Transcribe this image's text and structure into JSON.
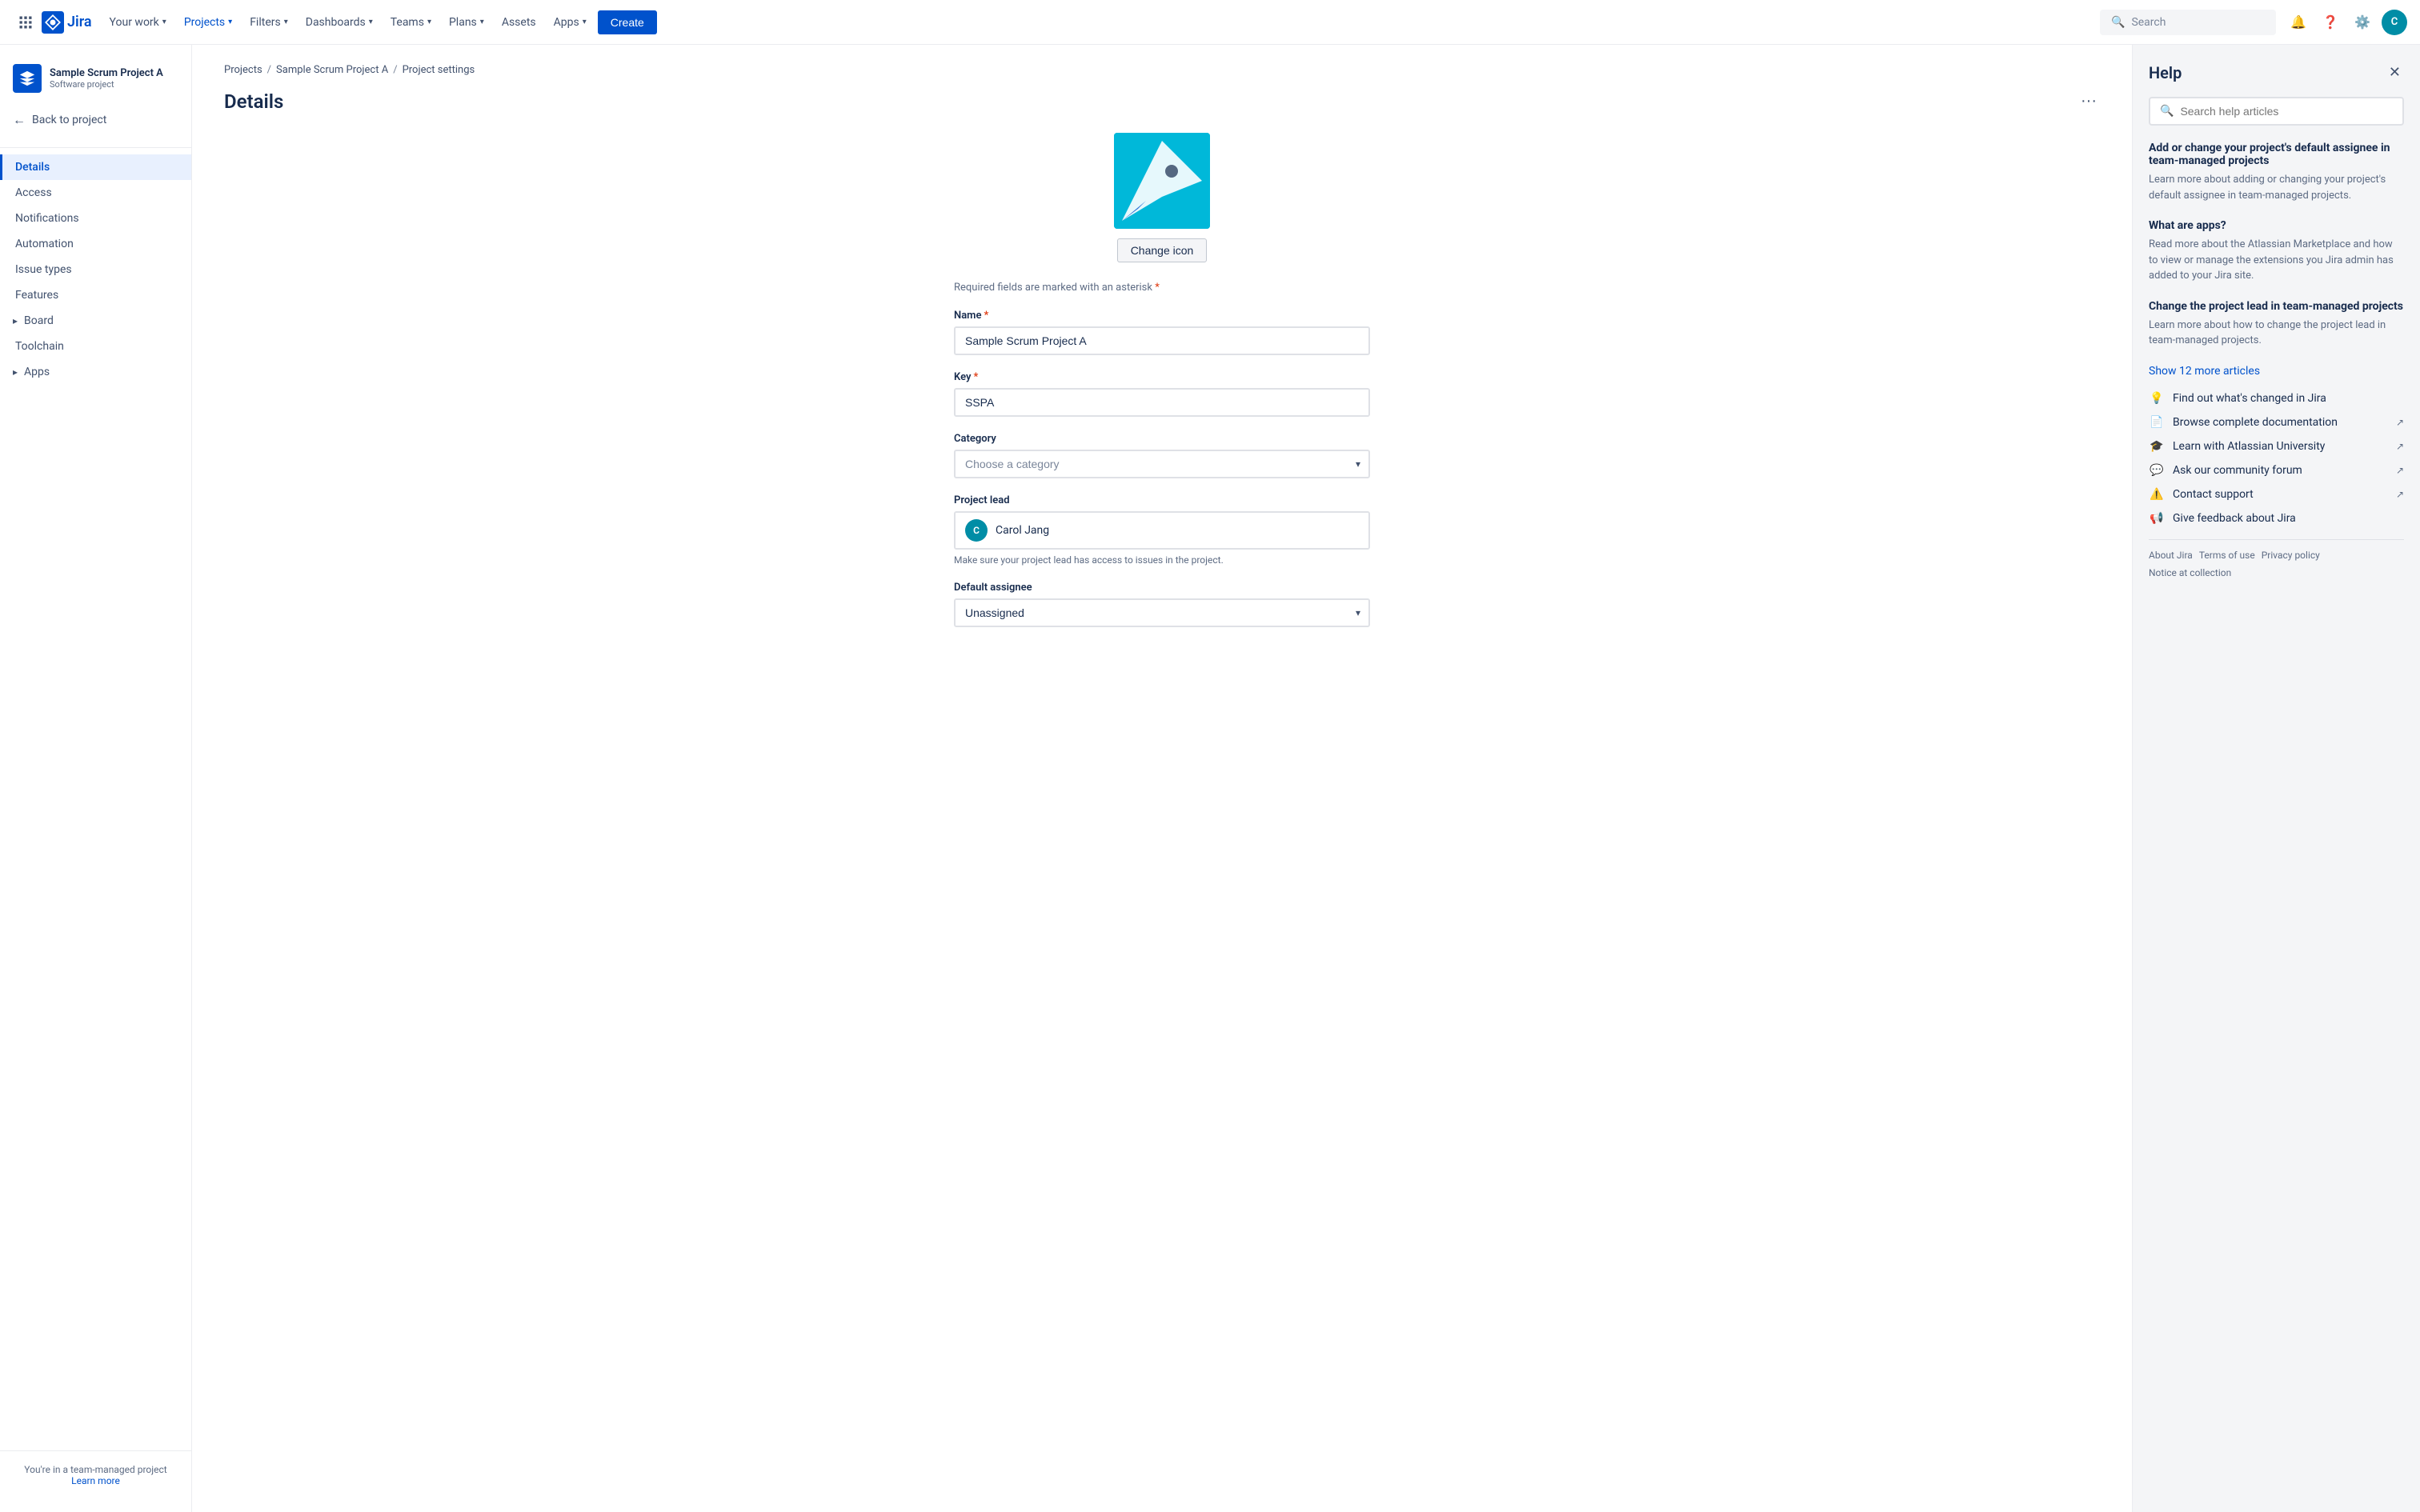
{
  "topnav": {
    "logo_text": "Jira",
    "search_placeholder": "Search",
    "nav_items": [
      {
        "label": "Your work",
        "has_chevron": true,
        "active": false
      },
      {
        "label": "Projects",
        "has_chevron": true,
        "active": true
      },
      {
        "label": "Filters",
        "has_chevron": true,
        "active": false
      },
      {
        "label": "Dashboards",
        "has_chevron": true,
        "active": false
      },
      {
        "label": "Teams",
        "has_chevron": true,
        "active": false
      },
      {
        "label": "Plans",
        "has_chevron": true,
        "active": false
      },
      {
        "label": "Assets",
        "has_chevron": false,
        "active": false
      },
      {
        "label": "Apps",
        "has_chevron": true,
        "active": false
      }
    ],
    "create_label": "Create",
    "avatar_initials": "C"
  },
  "sidebar": {
    "project_name": "Sample Scrum Project A",
    "project_type": "Software project",
    "back_label": "Back to project",
    "items": [
      {
        "label": "Details",
        "active": true
      },
      {
        "label": "Access",
        "active": false
      },
      {
        "label": "Notifications",
        "active": false
      },
      {
        "label": "Automation",
        "active": false
      },
      {
        "label": "Issue types",
        "active": false
      },
      {
        "label": "Features",
        "active": false
      }
    ],
    "expandable_items": [
      {
        "label": "Board"
      },
      {
        "label": "Toolchain"
      },
      {
        "label": "Apps"
      }
    ],
    "footer_text": "You're in a team-managed project",
    "footer_link": "Learn more"
  },
  "breadcrumb": {
    "items": [
      "Projects",
      "Sample Scrum Project A",
      "Project settings"
    ]
  },
  "page": {
    "title": "Details"
  },
  "form": {
    "required_note": "Required fields are marked with an asterisk",
    "change_icon_label": "Change icon",
    "name_label": "Name",
    "name_value": "Sample Scrum Project A",
    "key_label": "Key",
    "key_value": "SSPA",
    "category_label": "Category",
    "category_placeholder": "Choose a category",
    "project_lead_label": "Project lead",
    "project_lead_name": "Carol Jang",
    "project_lead_avatar": "C",
    "project_lead_hint": "Make sure your project lead has access to issues in the project.",
    "default_assignee_label": "Default assignee",
    "default_assignee_value": "Unassigned"
  },
  "help": {
    "title": "Help",
    "search_placeholder": "Search help articles",
    "articles": [
      {
        "title": "Add or change your project's default assignee in team-managed projects",
        "desc": "Learn more about adding or changing your project's default assignee in team-managed projects."
      },
      {
        "title": "What are apps?",
        "desc": "Read more about the Atlassian Marketplace and how to view or manage the extensions you Jira admin has added to your Jira site."
      },
      {
        "title": "Change the project lead in team-managed projects",
        "desc": "Learn more about how to change the project lead in team-managed projects."
      }
    ],
    "show_more_label": "Show 12 more articles",
    "links": [
      {
        "icon": "bulb",
        "text": "Find out what's changed in Jira",
        "external": false
      },
      {
        "icon": "doc",
        "text": "Browse complete documentation",
        "external": true
      },
      {
        "icon": "graduation",
        "text": "Learn with Atlassian University",
        "external": true
      },
      {
        "icon": "community",
        "text": "Ask our community forum",
        "external": true
      },
      {
        "icon": "support",
        "text": "Contact support",
        "external": true
      },
      {
        "icon": "megaphone",
        "text": "Give feedback about Jira",
        "external": false
      }
    ],
    "footer_links": [
      "About Jira",
      "Terms of use",
      "Privacy policy",
      "Notice at collection"
    ]
  }
}
